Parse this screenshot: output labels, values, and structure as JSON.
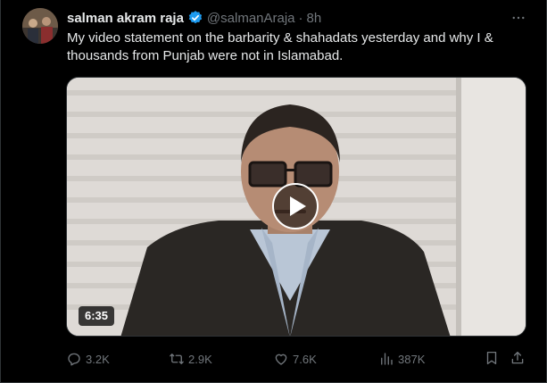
{
  "author": {
    "display_name": "salman akram raja",
    "handle": "@salmanAraja",
    "separator": "·",
    "time": "8h"
  },
  "tweet_text": "My video statement on the barbarity & shahadats yesterday and why I & thousands from Punjab were not in Islamabad.",
  "video": {
    "duration": "6:35"
  },
  "actions": {
    "replies": "3.2K",
    "reposts": "2.9K",
    "likes": "7.6K",
    "views": "387K"
  },
  "colors": {
    "background": "#000000",
    "text": "#e7e9ea",
    "muted": "#71767b",
    "verified": "#1d9bf0",
    "border": "#2f3336"
  },
  "icons": [
    "verified-badge-icon",
    "more-options-icon",
    "play-icon",
    "reply-icon",
    "repost-icon",
    "like-icon",
    "views-icon",
    "bookmark-icon",
    "share-icon"
  ]
}
